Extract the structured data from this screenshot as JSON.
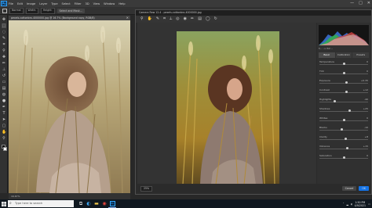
{
  "menubar": {
    "items": [
      "File",
      "Edit",
      "Image",
      "Layer",
      "Type",
      "Select",
      "Filter",
      "3D",
      "View",
      "Window",
      "Help"
    ],
    "window_controls": [
      "—",
      "□",
      "✕"
    ]
  },
  "options_bar": {
    "mode": "Normal",
    "width": "Width:",
    "height": "Height:",
    "select_mask": "Select and Mask..."
  },
  "document": {
    "tab_title": "pexels-cottonbro-4000000.jpg @ 16.7% (Background copy, RGB/8)",
    "status": "16.67%"
  },
  "camera_raw": {
    "title": "Camera Raw 12.4  -  pexels-cottonbro-4000000.jpg",
    "histogram_readout": "f/--   --s   ISO --",
    "tabs": [
      "Basic",
      "Calibration",
      "Presets"
    ],
    "sliders": [
      {
        "label": "Temperature",
        "value": "0",
        "pos": 0.5
      },
      {
        "label": "Tint",
        "value": "0",
        "pos": 0.5
      },
      {
        "label": "Exposure",
        "value": "+0.35",
        "pos": 0.56
      },
      {
        "label": "Contrast",
        "value": "+12",
        "pos": 0.56
      },
      {
        "label": "Highlights",
        "value": "-40",
        "pos": 0.3
      },
      {
        "label": "Shadows",
        "value": "+25",
        "pos": 0.62
      },
      {
        "label": "Whites",
        "value": "0",
        "pos": 0.5
      },
      {
        "label": "Blacks",
        "value": "-10",
        "pos": 0.45
      },
      {
        "label": "Clarity",
        "value": "+8",
        "pos": 0.54
      },
      {
        "label": "Vibrance",
        "value": "+15",
        "pos": 0.57
      },
      {
        "label": "Saturation",
        "value": "0",
        "pos": 0.5
      }
    ],
    "zoom": "25%",
    "buttons": {
      "cancel": "Cancel",
      "ok": "OK"
    }
  },
  "taskbar": {
    "search_placeholder": "Type here to search",
    "time": "1:50 PM",
    "date": "4/9/2021"
  },
  "colors": {
    "ps_blue": "#31a8ff",
    "accent": "#1473e6"
  }
}
